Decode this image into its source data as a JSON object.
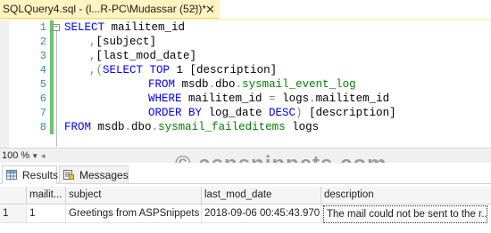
{
  "tab": {
    "title": "SQLQuery4.sql - (l...R-PC\\Mudassar (52))*",
    "pin_icon": "pin-icon",
    "close_icon": "close-icon",
    "close_glyph": "✕",
    "pin_glyph": "⊣"
  },
  "editor": {
    "lines": [
      {
        "n": "1"
      },
      {
        "n": "2"
      },
      {
        "n": "3"
      },
      {
        "n": "4"
      },
      {
        "n": "5"
      },
      {
        "n": "6"
      },
      {
        "n": "7"
      },
      {
        "n": "8"
      }
    ],
    "code": {
      "l1_kw": "SELECT",
      "l1_rest": " mailitem_id",
      "l2_comma": ",",
      "l2_rest": "[subject]",
      "l3_comma": ",",
      "l3_rest": "[last_mod_date]",
      "l4_comma": ",",
      "l4_paren": "(",
      "l4_kw": "SELECT TOP",
      "l4_rest": " 1 [description]",
      "l5_kw": "FROM",
      "l5_db": " msdb",
      "l5_dot1": ".",
      "l5_schema": "dbo",
      "l5_dot2": ".",
      "l5_table": "sysmail_event_log",
      "l6_kw": "WHERE",
      "l6_rest": " mailitem_id ",
      "l6_eq": "=",
      "l6_rest2": " logs",
      "l6_dot": ".",
      "l6_col": "mailitem_id",
      "l7_kw": "ORDER BY",
      "l7_rest": " log_date ",
      "l7_desc": "DESC",
      "l7_paren": ")",
      "l7_alias": " [description]",
      "l8_kw": "FROM",
      "l8_db": " msdb",
      "l8_dot1": ".",
      "l8_schema": "dbo",
      "l8_dot2": ".",
      "l8_table": "sysmail_faileditems",
      "l8_alias": " logs"
    },
    "fold_glyph": "−"
  },
  "zoom": {
    "value": "100 %",
    "arrow": "▼",
    "scroll_glyph": "◂"
  },
  "watermark": "© aspsnippets.com",
  "results_tabs": [
    {
      "label": "Results",
      "icon": "results-grid-icon"
    },
    {
      "label": "Messages",
      "icon": "messages-icon"
    }
  ],
  "grid": {
    "columns": [
      "",
      "mailit...",
      "subject",
      "last_mod_date",
      "description"
    ],
    "rows": [
      [
        "1",
        "1",
        "Greetings from ASPSnippets",
        "2018-09-06 00:45:43.970",
        "The mail could not be sent to the r..."
      ]
    ]
  }
}
